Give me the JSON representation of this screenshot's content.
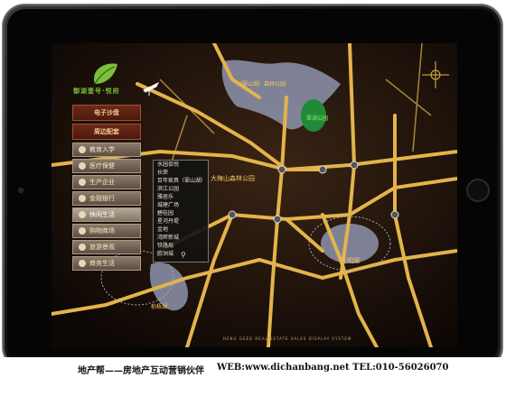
{
  "menu": {
    "head1": "电子沙盘",
    "head2": "周边配套",
    "items": [
      "教育入学",
      "医疗保健",
      "生产企业",
      "金融银行",
      "休闲生活",
      "购物商场",
      "旅游景观",
      "商务生活"
    ]
  },
  "logo": {
    "text": "御湖壹号·悦府"
  },
  "popup": {
    "items": [
      "水园佰悦",
      "长荣",
      "百年家具（翠山湖）",
      "滨江公园",
      "雅居乐",
      "城建广场",
      "碧桂园",
      "星河丹堤",
      "金地",
      "湾畔新城",
      "铁路局",
      "欧洲城",
      "东部华侨城"
    ],
    "search_icon": "search-icon"
  },
  "map_labels": {
    "lake": "（翠山湖）森林公园",
    "park": "大梅山森林公园",
    "lake2": "光明湖",
    "lake3": "柏梧湖",
    "green": "翠湖公园"
  },
  "footer_small": "HENG GEED REAL ESTATE SALES DISPLAY SYSTEM",
  "caption": {
    "left": "地产帮——房地产互动营销伙伴",
    "web": "WEB:www.dichanbang.net",
    "tel": "TEL:010-56026070"
  },
  "colors": {
    "road": "#e3b44a",
    "lake": "#9aa0b8",
    "menu_head": "#6c2a18"
  }
}
